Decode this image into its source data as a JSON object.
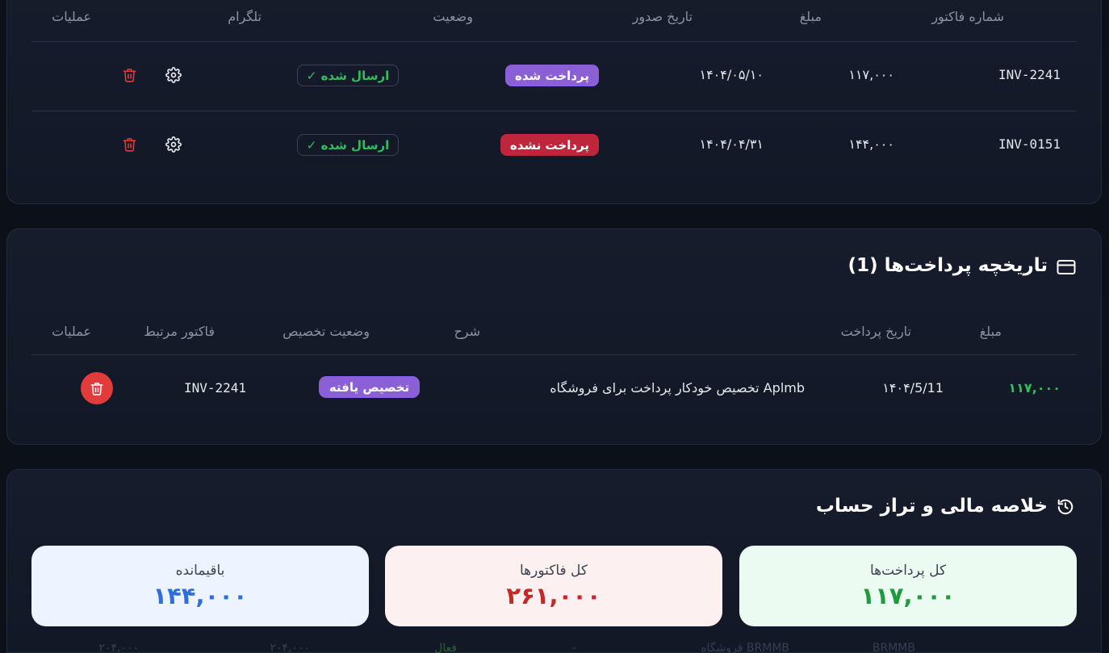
{
  "invoices": {
    "headers": {
      "number": "شماره فاکتور",
      "amount": "مبلغ",
      "issue_date": "تاریخ صدور",
      "status": "وضعیت",
      "telegram": "تلگرام",
      "actions": "عملیات"
    },
    "rows": [
      {
        "number": "INV-2241",
        "amount": "۱۱۷,۰۰۰",
        "date": "۱۴۰۴/۰۵/۱۰",
        "status": "پرداخت شده",
        "status_color": "#8b5fd6",
        "telegram": "✓ ارسال شده"
      },
      {
        "number": "INV-0151",
        "amount": "۱۴۴,۰۰۰",
        "date": "۱۴۰۴/۰۴/۳۱",
        "status": "پرداخت نشده",
        "status_color": "#c0263b",
        "telegram": "✓ ارسال شده"
      }
    ]
  },
  "payments": {
    "title": "تاریخچه پرداخت‌ها (1)",
    "headers": {
      "amount": "مبلغ",
      "date": "تاریخ پرداخت",
      "description": "شرح",
      "allocation_status": "وضعیت تخصیص",
      "related_invoice": "فاکتور مرتبط",
      "actions": "عملیات"
    },
    "rows": [
      {
        "amount": "۱۱۷,۰۰۰",
        "date": "۱۴۰۴/5/11",
        "description": "تخصیص خودکار پرداخت برای فروشگاه Aplmb",
        "allocation": "تخصیص یافته",
        "invoice": "INV-2241"
      }
    ]
  },
  "summary": {
    "title": "خلاصه مالی و تراز حساب",
    "cards": [
      {
        "label": "کل پرداخت‌ها",
        "value": "۱۱۷,۰۰۰",
        "bg": "#ecfbf1",
        "color": "#1f9a3e"
      },
      {
        "label": "کل فاکتورها",
        "value": "۲۶۱,۰۰۰",
        "bg": "#fdf0f0",
        "color": "#c62828"
      },
      {
        "label": "باقیمانده",
        "value": "۱۴۴,۰۰۰",
        "bg": "#eef4ff",
        "color": "#2f6fdb"
      }
    ]
  },
  "background_row": {
    "code": "BRMMB",
    "shop": "فروشگاه BRMMB",
    "dash": "-",
    "badge": "فعال",
    "amount1": "۲۰۴,۰۰۰",
    "amount2": "۲۰۴,۰۰۰"
  },
  "colors": {
    "accent_purple": "#8b5fd6",
    "danger": "#e23b3b",
    "success": "#2fbf5b"
  }
}
